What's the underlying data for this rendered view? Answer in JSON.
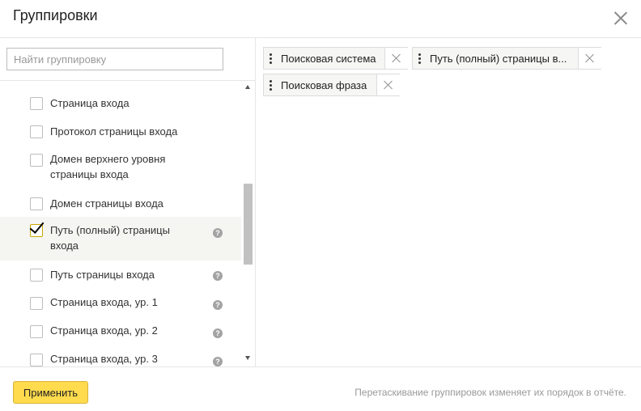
{
  "dialog": {
    "title": "Группировки"
  },
  "search": {
    "placeholder": "Найти группировку",
    "value": ""
  },
  "list": {
    "items": [
      {
        "label": "Страница входа",
        "checked": false,
        "help": false
      },
      {
        "label": "Протокол страницы входа",
        "checked": false,
        "help": false
      },
      {
        "label": "Домен верхнего уровня страницы входа",
        "checked": false,
        "help": false
      },
      {
        "label": "Домен страницы входа",
        "checked": false,
        "help": false
      },
      {
        "label": "Путь (полный) страницы входа",
        "checked": true,
        "help": true
      },
      {
        "label": "Путь страницы входа",
        "checked": false,
        "help": true
      },
      {
        "label": "Страница входа, ур. 1",
        "checked": false,
        "help": true
      },
      {
        "label": "Страница входа, ур. 2",
        "checked": false,
        "help": true
      },
      {
        "label": "Страница входа, ур. 3",
        "checked": false,
        "help": true
      }
    ],
    "help_glyph": "?"
  },
  "selected_groupings": [
    {
      "label": "Поисковая система"
    },
    {
      "label": "Путь (полный) страницы в..."
    },
    {
      "label": "Поисковая фраза"
    }
  ],
  "footer": {
    "apply_label": "Применить",
    "hint": "Перетаскивание группировок изменяет их порядок в отчёте."
  },
  "colors": {
    "accent": "#ffdb4d",
    "selected_row": "#f5f5f2",
    "chip_bg": "#f6f6f4"
  },
  "icons": {
    "close": "close-icon",
    "help": "help-icon",
    "remove": "remove-chip-icon",
    "drag": "drag-handle-icon"
  }
}
